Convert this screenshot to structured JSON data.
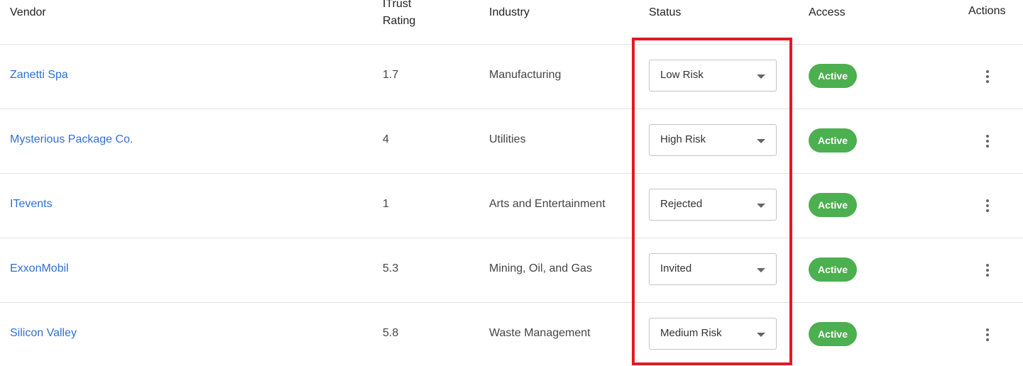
{
  "header": {
    "vendor": "Vendor",
    "rating_line1": "ITrust",
    "rating_line2": "Rating",
    "industry": "Industry",
    "status": "Status",
    "access": "Access",
    "actions": "Actions"
  },
  "rows": [
    {
      "vendor": "Zanetti Spa",
      "rating": "1.7",
      "industry": "Manufacturing",
      "status": "Low Risk",
      "access": "Active"
    },
    {
      "vendor": "Mysterious Package Co.",
      "rating": "4",
      "industry": "Utilities",
      "status": "High Risk",
      "access": "Active"
    },
    {
      "vendor": "ITevents",
      "rating": "1",
      "industry": "Arts and Entertainment",
      "status": "Rejected",
      "access": "Active"
    },
    {
      "vendor": "ExxonMobil",
      "rating": "5.3",
      "industry": "Mining, Oil, and Gas",
      "status": "Invited",
      "access": "Active"
    },
    {
      "vendor": "Silicon Valley",
      "rating": "5.8",
      "industry": "Waste Management",
      "status": "Medium Risk",
      "access": "Active"
    }
  ],
  "icons": {
    "dropdown": "chevron-down-icon",
    "row_actions": "more-vertical-icon"
  },
  "colors": {
    "link": "#2f6fd4",
    "active_badge": "#4caf50",
    "highlight_border": "#e11b22"
  }
}
